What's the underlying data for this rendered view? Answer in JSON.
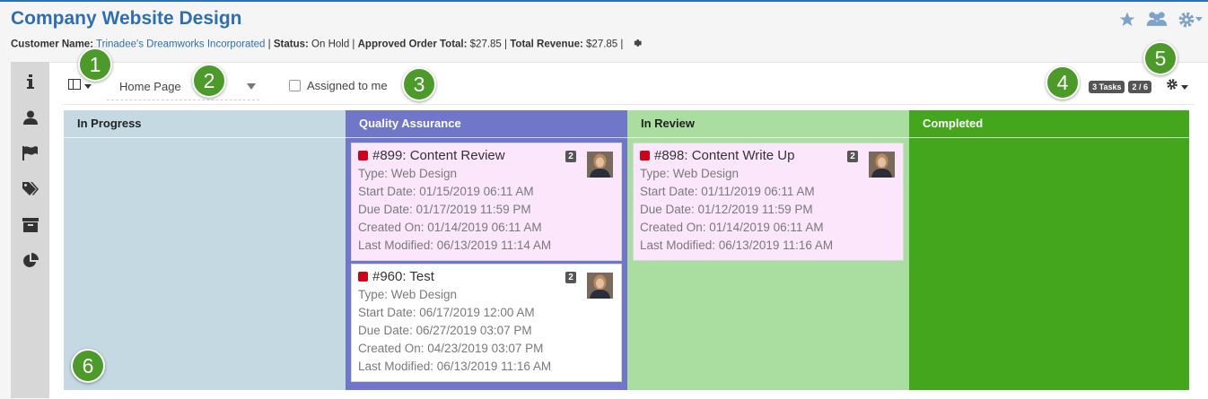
{
  "header": {
    "title": "Company Website Design",
    "customer_label": "Customer Name:",
    "customer_value": "Trinadee's Dreamworks Incorporated",
    "status_label": "Status:",
    "status_value": "On Hold",
    "approved_label": "Approved Order Total:",
    "approved_value": "$27.85",
    "revenue_label": "Total Revenue:",
    "revenue_value": "$27.85",
    "sep": "|"
  },
  "toolbar": {
    "page_select_value": "Home Page",
    "assigned_label": "Assigned to me",
    "tasks_badge": "3 Tasks",
    "page_badge": "2 / 6"
  },
  "callouts": [
    "1",
    "2",
    "3",
    "4",
    "5",
    "6"
  ],
  "columns": [
    {
      "name": "In Progress",
      "bg": "#c5d9e3",
      "head_color": "#222222",
      "cards": []
    },
    {
      "name": "Quality Assurance",
      "bg": "#7076c8",
      "head_color": "#ffffff",
      "cards": [
        {
          "title": "#899: Content Review",
          "count": "2",
          "type": "Type: Web Design",
          "start": "Start Date: 01/15/2019 06:11 AM",
          "due": "Due Date: 01/17/2019 11:59 PM",
          "created": "Created On: 01/14/2019 06:11 AM",
          "modified": "Last Modified: 06/13/2019 11:14 AM",
          "bg": "#fbe6fb"
        },
        {
          "title": "#960: Test",
          "count": "2",
          "type": "Type: Web Design",
          "start": "Start Date: 06/17/2019 12:00 AM",
          "due": "Due Date: 06/27/2019 03:07 PM",
          "created": "Created On: 04/23/2019 03:07 PM",
          "modified": "Last Modified: 06/13/2019 11:16 AM",
          "bg": "#ffffff"
        }
      ]
    },
    {
      "name": "In Review",
      "bg": "#aadea1",
      "head_color": "#222222",
      "cards": [
        {
          "title": "#898: Content Write Up",
          "count": "2",
          "type": "Type: Web Design",
          "start": "Start Date: 01/11/2019 06:11 AM",
          "due": "Due Date: 01/12/2019 11:59 PM",
          "created": "Created On: 01/14/2019 06:11 AM",
          "modified": "Last Modified: 06/13/2019 11:16 AM",
          "bg": "#fbe6fb"
        }
      ]
    },
    {
      "name": "Completed",
      "bg": "#44a61c",
      "head_color": "#ffffff",
      "cards": []
    }
  ],
  "colors": {
    "accent": "#2f6fb0",
    "callout": "#4b9a2a",
    "priority": "#d0021b"
  },
  "icons": {
    "header": [
      "star-icon",
      "users-icon",
      "gear-icon"
    ],
    "sidebar": [
      "info-icon",
      "user-icon",
      "flag-icon",
      "tags-icon",
      "archive-icon",
      "pie-chart-icon"
    ]
  }
}
